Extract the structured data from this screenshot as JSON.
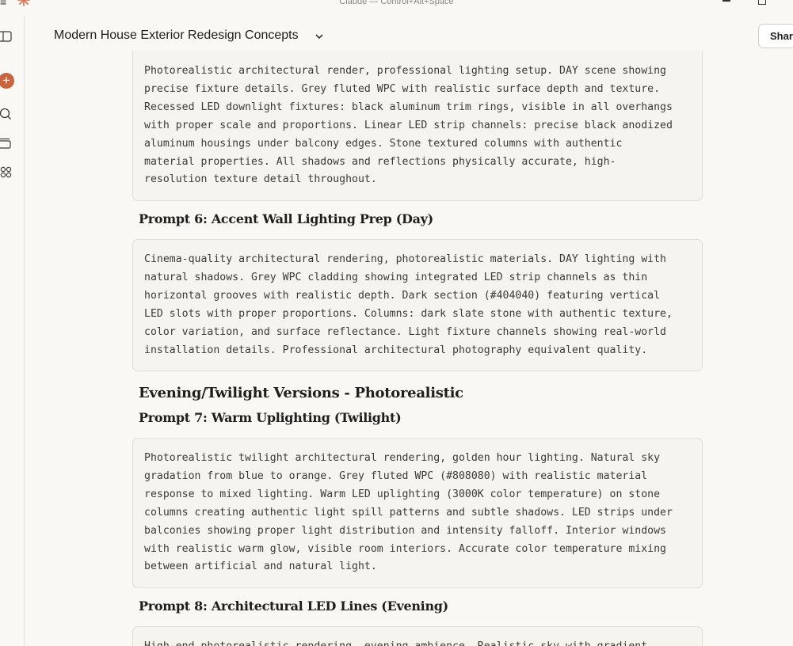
{
  "window": {
    "title": "Claude — Control+Alt+Space"
  },
  "header": {
    "conversation_title": "Modern House Exterior Redesign Concepts",
    "share_label": "Share"
  },
  "colors": {
    "accent": "#c96442",
    "background": "#f9f8f5",
    "code_background": "#f5f4ef"
  },
  "rail": {
    "icons": [
      "sidebar-toggle-icon",
      "new-chat-icon",
      "search-icon",
      "chats-icon",
      "artifacts-icon"
    ]
  },
  "messages": {
    "block_5_text": "Photorealistic architectural render, professional lighting setup. DAY scene showing\nprecise fixture details. Grey fluted WPC with realistic surface depth and texture.\nRecessed LED downlight fixtures: black aluminum trim rings, visible in all overhangs\nwith proper scale and proportions. Linear LED strip channels: precise black anodized\naluminum housings under balcony edges. Stone textured columns with authentic\nmaterial properties. All shadows and reflections physically accurate, high-\nresolution texture detail throughout.",
    "prompt6_heading": "Prompt 6: Accent Wall Lighting Prep (Day)",
    "block_6_text": "Cinema-quality architectural rendering, photorealistic materials. DAY lighting with\nnatural shadows. Grey WPC cladding showing integrated LED strip channels as thin\nhorizontal grooves with realistic depth. Dark section (#404040) featuring vertical\nLED slots with proper proportions. Columns: dark slate stone with authentic texture,\ncolor variation, and surface reflectance. Light fixture channels showing real-world\ninstallation details. Professional architectural photography equivalent quality.",
    "section_heading": "Evening/Twilight Versions - Photorealistic",
    "prompt7_heading": "Prompt 7: Warm Uplighting (Twilight)",
    "block_7_text": "Photorealistic twilight architectural rendering, golden hour lighting. Natural sky\ngradation from blue to orange. Grey fluted WPC (#808080) with realistic material\nresponse to mixed lighting. Warm LED uplighting (3000K color temperature) on stone\ncolumns creating authentic light spill patterns and subtle shadows. LED strips under\nbalconies showing proper light distribution and intensity falloff. Interior windows\nwith realistic warm glow, visible room interiors. Accurate color temperature mixing\nbetween artificial and natural light.",
    "prompt8_heading": "Prompt 8: Architectural LED Lines (Evening)",
    "block_8_text": "High-end photorealistic rendering, evening ambience. Realistic sky with gradient"
  }
}
